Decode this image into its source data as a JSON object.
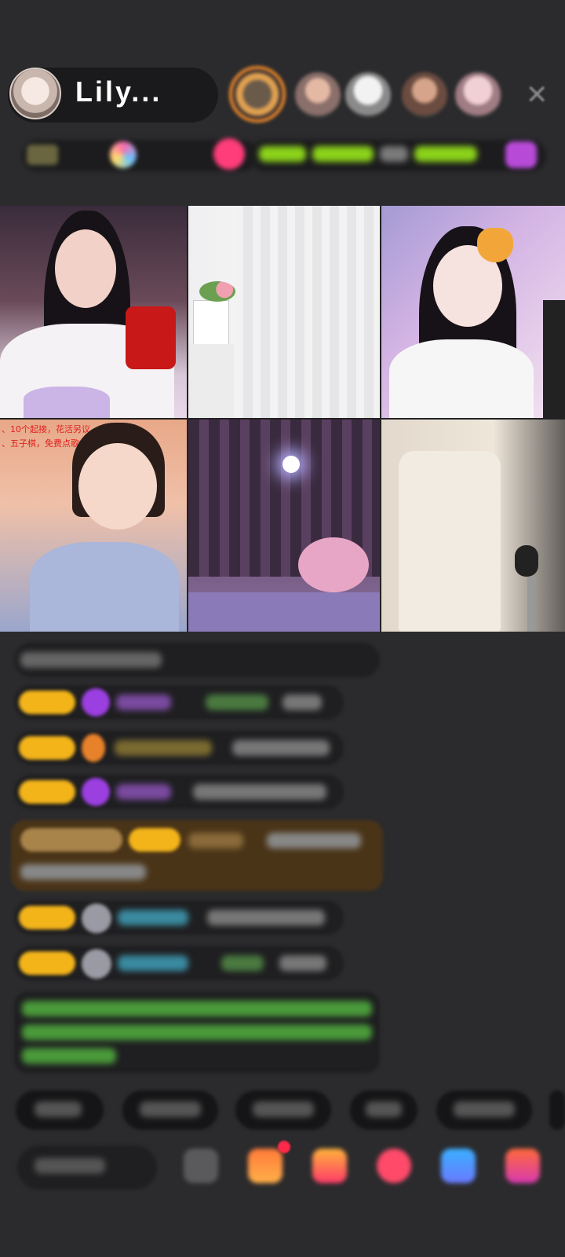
{
  "header": {
    "host_name": "Lily...",
    "close_icon": "close-icon"
  },
  "overlays": {
    "cell4_line1": "、10个起接，花活另议",
    "cell4_line2": "、五子棋，免费点歌"
  },
  "colors": {
    "background": "#2b2b2d",
    "badge_gold": "#f3b41a",
    "gift_purple": "#9b3fe0",
    "pink_live": "#ff3d7a"
  }
}
